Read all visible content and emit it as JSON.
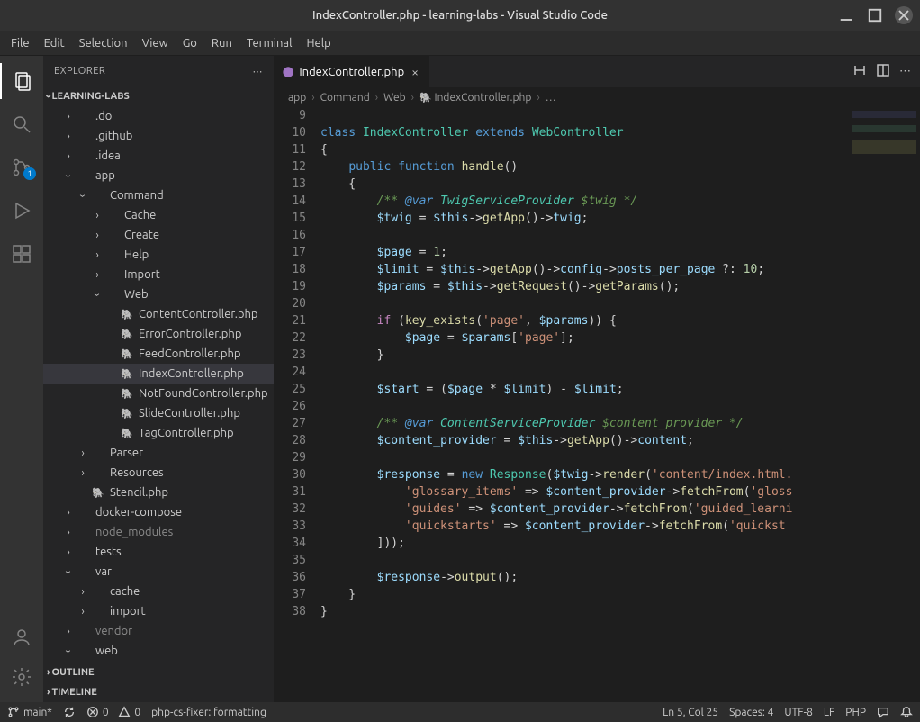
{
  "title": "IndexController.php - learning-labs - Visual Studio Code",
  "menu": [
    "File",
    "Edit",
    "Selection",
    "View",
    "Go",
    "Run",
    "Terminal",
    "Help"
  ],
  "explorer_label": "EXPLORER",
  "project_name": "LEARNING-LABS",
  "outline_label": "OUTLINE",
  "timeline_label": "TIMELINE",
  "scm_badge": "1",
  "tree": [
    {
      "depth": 1,
      "chev": ">",
      "label": ".do",
      "type": "folder"
    },
    {
      "depth": 1,
      "chev": ">",
      "label": ".github",
      "type": "folder"
    },
    {
      "depth": 1,
      "chev": ">",
      "label": ".idea",
      "type": "folder"
    },
    {
      "depth": 1,
      "chev": "v",
      "label": "app",
      "type": "folder"
    },
    {
      "depth": 2,
      "chev": "v",
      "label": "Command",
      "type": "folder"
    },
    {
      "depth": 3,
      "chev": ">",
      "label": "Cache",
      "type": "folder"
    },
    {
      "depth": 3,
      "chev": ">",
      "label": "Create",
      "type": "folder"
    },
    {
      "depth": 3,
      "chev": ">",
      "label": "Help",
      "type": "folder"
    },
    {
      "depth": 3,
      "chev": ">",
      "label": "Import",
      "type": "folder"
    },
    {
      "depth": 3,
      "chev": "v",
      "label": "Web",
      "type": "folder"
    },
    {
      "depth": 4,
      "label": "ContentController.php",
      "type": "php"
    },
    {
      "depth": 4,
      "label": "ErrorController.php",
      "type": "php"
    },
    {
      "depth": 4,
      "label": "FeedController.php",
      "type": "php"
    },
    {
      "depth": 4,
      "label": "IndexController.php",
      "type": "php",
      "selected": true
    },
    {
      "depth": 4,
      "label": "NotFoundController.php",
      "type": "php"
    },
    {
      "depth": 4,
      "label": "SlideController.php",
      "type": "php"
    },
    {
      "depth": 4,
      "label": "TagController.php",
      "type": "php"
    },
    {
      "depth": 2,
      "chev": ">",
      "label": "Parser",
      "type": "folder"
    },
    {
      "depth": 2,
      "chev": ">",
      "label": "Resources",
      "type": "folder"
    },
    {
      "depth": 2,
      "label": "Stencil.php",
      "type": "php"
    },
    {
      "depth": 1,
      "chev": ">",
      "label": "docker-compose",
      "type": "folder"
    },
    {
      "depth": 1,
      "chev": ">",
      "label": "node_modules",
      "type": "folder",
      "dim": true
    },
    {
      "depth": 1,
      "chev": ">",
      "label": "tests",
      "type": "folder"
    },
    {
      "depth": 1,
      "chev": "v",
      "label": "var",
      "type": "folder"
    },
    {
      "depth": 2,
      "chev": ">",
      "label": "cache",
      "type": "folder"
    },
    {
      "depth": 2,
      "chev": ">",
      "label": "import",
      "type": "folder"
    },
    {
      "depth": 1,
      "chev": ">",
      "label": "vendor",
      "type": "folder",
      "dim": true
    },
    {
      "depth": 1,
      "chev": "v",
      "label": "web",
      "type": "folder"
    }
  ],
  "tab_label": "IndexController.php",
  "breadcrumb": [
    "app",
    "Command",
    "Web",
    "IndexController.php",
    "…"
  ],
  "first_line_no": 9,
  "code_lines": [
    "",
    "<span class='tok-kw'>class</span> <span class='tok-type'>IndexController</span> <span class='tok-kw'>extends</span> <span class='tok-type'>WebController</span>",
    "{",
    "    <span class='tok-kw'>public</span> <span class='tok-kw'>function</span> <span class='tok-fn'>handle</span>()",
    "    {",
    "        <span class='tok-comment'>/** <span class='tok-doctag'>@var</span> <span class='tok-doctype'>TwigServiceProvider</span> $twig */</span>",
    "        <span class='tok-var'>$twig</span> = <span class='tok-var'>$this</span>-><span class='tok-fn'>getApp</span>()-><span class='tok-var'>twig</span>;",
    "",
    "        <span class='tok-var'>$page</span> = <span class='tok-num'>1</span>;",
    "        <span class='tok-var'>$limit</span> = <span class='tok-var'>$this</span>-><span class='tok-fn'>getApp</span>()-><span class='tok-var'>config</span>-><span class='tok-var'>posts_per_page</span> ?: <span class='tok-num'>10</span>;",
    "        <span class='tok-var'>$params</span> = <span class='tok-var'>$this</span>-><span class='tok-fn'>getRequest</span>()-><span class='tok-fn'>getParams</span>();",
    "",
    "        <span class='tok-ctrl'>if</span> (<span class='tok-fn'>key_exists</span>(<span class='tok-str'>'page'</span>, <span class='tok-var'>$params</span>)) {",
    "            <span class='tok-var'>$page</span> = <span class='tok-var'>$params</span>[<span class='tok-str'>'page'</span>];",
    "        }",
    "",
    "        <span class='tok-var'>$start</span> = (<span class='tok-var'>$page</span> * <span class='tok-var'>$limit</span>) - <span class='tok-var'>$limit</span>;",
    "",
    "        <span class='tok-comment'>/** <span class='tok-doctag'>@var</span> <span class='tok-doctype'>ContentServiceProvider</span> $content_provider */</span>",
    "        <span class='tok-var'>$content_provider</span> = <span class='tok-var'>$this</span>-><span class='tok-fn'>getApp</span>()-><span class='tok-var'>content</span>;",
    "",
    "        <span class='tok-var'>$response</span> = <span class='tok-kw'>new</span> <span class='tok-type'>Response</span>(<span class='tok-var'>$twig</span>-><span class='tok-fn'>render</span>(<span class='tok-str'>'content/index.html.</span>",
    "            <span class='tok-str'>'glossary_items'</span> =&gt; <span class='tok-var'>$content_provider</span>-><span class='tok-fn'>fetchFrom</span>(<span class='tok-str'>'gloss</span>",
    "            <span class='tok-str'>'guides'</span> =&gt; <span class='tok-var'>$content_provider</span>-><span class='tok-fn'>fetchFrom</span>(<span class='tok-str'>'guided_learni</span>",
    "            <span class='tok-str'>'quickstarts'</span> =&gt; <span class='tok-var'>$content_provider</span>-><span class='tok-fn'>fetchFrom</span>(<span class='tok-str'>'quickst</span>",
    "        ]));",
    "",
    "        <span class='tok-var'>$response</span>-><span class='tok-fn'>output</span>();",
    "    }",
    "}"
  ],
  "status": {
    "branch": "main*",
    "errors": "0",
    "warnings": "0",
    "formatter": "php-cs-fixer: formatting",
    "position": "Ln 5, Col 25",
    "spaces": "Spaces: 4",
    "encoding": "UTF-8",
    "eol": "LF",
    "language": "PHP"
  }
}
